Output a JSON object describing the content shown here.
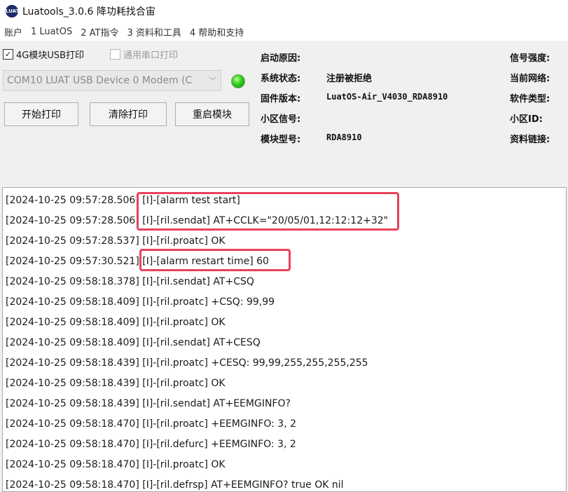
{
  "window": {
    "title": "Luatools_3.0.6 降功耗找合宙",
    "icon_name": "luatools-logo-icon",
    "icon_text": "LUAT"
  },
  "menu": {
    "items": [
      "账户",
      "1 LuatOS",
      "2 AT指令",
      "3 资料和工具",
      "4 帮助和支持"
    ]
  },
  "toolbar": {
    "usb_print_label": "4G模块USB打印",
    "usb_print_checked": true,
    "serial_print_label": "通用串口打印",
    "serial_print_checked": false,
    "port_selected": "COM10 LUAT USB Device 0 Modem (C",
    "status_led_color": "#2ecc1f",
    "start_label": "开始打印",
    "clear_label": "清除打印",
    "restart_label": "重启模块"
  },
  "info": {
    "boot_reason_label": "启动原因:",
    "boot_reason_value": "",
    "system_status_label": "系统状态:",
    "system_status_value": "注册被拒绝",
    "firmware_label": "固件版本:",
    "firmware_value": "LuatOS-Air_V4030_RDA8910",
    "cell_signal_label": "小区信号:",
    "cell_signal_value": "",
    "module_type_label": "模块型号:",
    "module_type_value": "RDA8910",
    "signal_strength_label": "信号强度:",
    "current_network_label": "当前网络:",
    "software_type_label": "软件类型:",
    "cell_id_label": "小区ID:",
    "docs_link_label": "资料链接:"
  },
  "log": {
    "highlight_color": "#e8425a",
    "lines": [
      "[2024-10-25 09:57:28.506] [I]-[alarm test start]",
      "[2024-10-25 09:57:28.506] [I]-[ril.sendat] AT+CCLK=\"20/05/01,12:12:12+32\"",
      "[2024-10-25 09:57:28.537] [I]-[ril.proatc] OK",
      "[2024-10-25 09:57:30.521] [I]-[alarm restart time] 60",
      "[2024-10-25 09:58:18.378] [I]-[ril.sendat] AT+CSQ",
      "[2024-10-25 09:58:18.409] [I]-[ril.proatc] +CSQ: 99,99",
      "[2024-10-25 09:58:18.409] [I]-[ril.proatc] OK",
      "[2024-10-25 09:58:18.409] [I]-[ril.sendat] AT+CESQ",
      "[2024-10-25 09:58:18.439] [I]-[ril.proatc] +CESQ: 99,99,255,255,255,255",
      "[2024-10-25 09:58:18.439] [I]-[ril.proatc] OK",
      "[2024-10-25 09:58:18.439] [I]-[ril.sendat] AT+EEMGINFO?",
      "[2024-10-25 09:58:18.470] [I]-[ril.proatc] +EEMGINFO: 3, 2",
      "[2024-10-25 09:58:18.470] [I]-[ril.defurc] +EEMGINFO: 3, 2",
      "[2024-10-25 09:58:18.470] [I]-[ril.proatc] OK",
      "[2024-10-25 09:58:18.470] [I]-[ril.defrsp] AT+EEMGINFO? true OK nil"
    ]
  }
}
